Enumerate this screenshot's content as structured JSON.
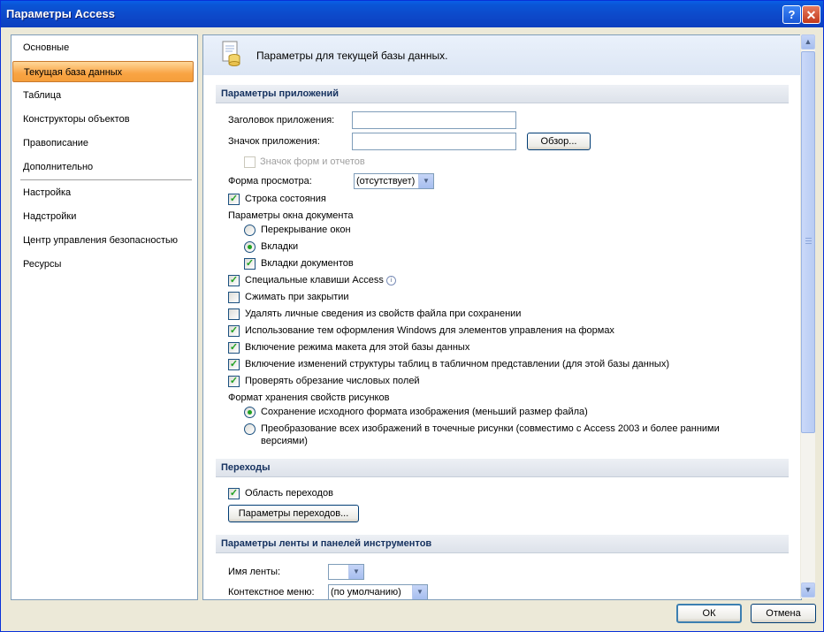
{
  "window": {
    "title": "Параметры Access"
  },
  "nav": {
    "items": [
      "Основные",
      "Текущая база данных",
      "Таблица",
      "Конструкторы объектов",
      "Правописание",
      "Дополнительно",
      "Настройка",
      "Надстройки",
      "Центр управления безопасностью",
      "Ресурсы"
    ],
    "selected": "Текущая база данных"
  },
  "header": {
    "title": "Параметры для текущей базы данных."
  },
  "app_options": {
    "section_title": "Параметры приложений",
    "app_title_label": "Заголовок приложения:",
    "app_title_value": "",
    "app_icon_label": "Значок приложения:",
    "app_icon_value": "",
    "browse_label": "Обзор...",
    "forms_icon_label": "Значок форм и отчетов",
    "display_form_label": "Форма просмотра:",
    "display_form_value": "(отсутствует)",
    "status_bar_label": "Строка состояния",
    "doc_window_label": "Параметры окна документа",
    "overlap_label": "Перекрывание окон",
    "tabbed_label": "Вкладки",
    "doc_tabs_label": "Вкладки документов",
    "special_keys_label": "Специальные клавиши Access",
    "compact_label": "Сжимать при закрытии",
    "remove_personal_label": "Удалять личные сведения из свойств файла при сохранении",
    "windows_themes_label": "Использование тем оформления Windows для элементов управления на формах",
    "layout_view_label": "Включение режима макета для этой базы данных",
    "design_changes_label": "Включение изменений структуры таблиц в табличном представлении (для этой базы данных)",
    "truncated_fields_label": "Проверять обрезание числовых полей",
    "picture_format_label": "Формат хранения свойств рисунков",
    "preserve_format_label": "Сохранение исходного формата изображения (меньший размер файла)",
    "convert_bitmaps_label_line1": "Преобразование всех изображений в точечные рисунки (совместимо с Access 2003 и более ранними",
    "convert_bitmaps_label_line2": "версиями)"
  },
  "navigation": {
    "section_title": "Переходы",
    "nav_pane_label": "Область переходов",
    "nav_options_button": "Параметры переходов..."
  },
  "ribbon": {
    "section_title": "Параметры ленты и панелей инструментов",
    "ribbon_name_label": "Имя ленты:",
    "ribbon_name_value": "",
    "shortcut_menu_label": "Контекстное меню:",
    "shortcut_menu_value": "(по умолчанию)"
  },
  "checked": {
    "status_bar": true,
    "forms_icon": false,
    "overlap": false,
    "tabbed": true,
    "doc_tabs": true,
    "special_keys": true,
    "compact": false,
    "remove_personal": false,
    "windows_themes": true,
    "layout_view": true,
    "design_changes": true,
    "truncated_fields": true,
    "preserve_format": true,
    "convert_bitmaps": false,
    "nav_pane": true
  },
  "footer": {
    "ok_label": "ОК",
    "cancel_label": "Отмена"
  },
  "icons": {
    "help": "help-icon",
    "close": "close-icon",
    "info": "info-icon",
    "db_options": "database-options-icon"
  },
  "colors": {
    "titlebar": "#0A55D6",
    "selected_nav": "#F9A444",
    "check": "#21A121"
  }
}
